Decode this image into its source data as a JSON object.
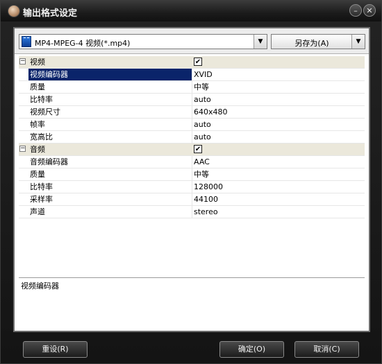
{
  "window": {
    "title": "输出格式设定"
  },
  "format": {
    "selected": "MP4-MPEG-4 视频(*.mp4)",
    "save_as": "另存为(A)"
  },
  "video": {
    "category": "视频",
    "properties": [
      {
        "name": "视频编码器",
        "value": "XVID"
      },
      {
        "name": "质量",
        "value": "中等"
      },
      {
        "name": "比特率",
        "value": "auto"
      },
      {
        "name": "视频尺寸",
        "value": "640x480"
      },
      {
        "name": "帧率",
        "value": "auto"
      },
      {
        "name": "宽高比",
        "value": "auto"
      }
    ]
  },
  "audio": {
    "category": "音频",
    "properties": [
      {
        "name": "音频编码器",
        "value": "AAC"
      },
      {
        "name": "质量",
        "value": "中等"
      },
      {
        "name": "比特率",
        "value": "128000"
      },
      {
        "name": "采样率",
        "value": "44100"
      },
      {
        "name": "声道",
        "value": "stereo"
      }
    ]
  },
  "description": "视频编码器",
  "buttons": {
    "reset": "重设(R)",
    "ok": "确定(O)",
    "cancel": "取消(C)"
  }
}
